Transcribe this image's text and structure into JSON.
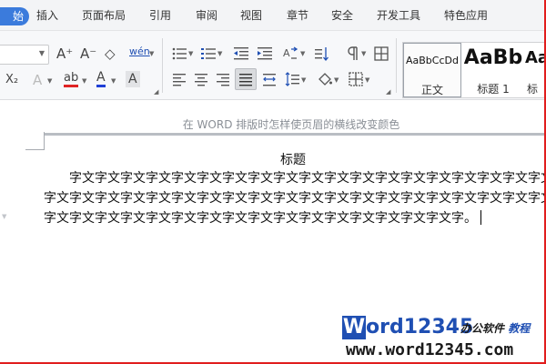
{
  "tabs": {
    "start": "始",
    "items": [
      "插入",
      "页面布局",
      "引用",
      "审阅",
      "视图",
      "章节",
      "安全",
      "开发工具",
      "特色应用"
    ]
  },
  "ribbon": {
    "font_name_value": "",
    "glyphs": {
      "grow_font": "A⁺",
      "shrink_font": "A⁻",
      "clear_format": "◇",
      "phonetic": "wén",
      "subscript": "X₂",
      "text_effect": "A",
      "highlight": "ab",
      "font_color": "A",
      "char_shading": "A"
    },
    "styles": [
      {
        "preview": "AaBbCcDd",
        "label": "正文"
      },
      {
        "preview": "AaBb",
        "label": "标题 1"
      },
      {
        "preview": "Aa",
        "label": "标"
      }
    ],
    "accent": "#3b7bdc"
  },
  "document": {
    "header_text": "在 WORD 排版时怎样使页眉的横线改变颜色",
    "title": "标题",
    "paragraph": "字文字文字文字文字文字文字文字文字文字文字文字文字文字文字文字文字文字文字文字文字文字文字文字文字文字文字文字文字文字文字文字文字文字文字文字文字文字文字文字文字文字文字文字文字文字文字文字文字文字文字文字文字文字文字文字。"
  },
  "watermark": {
    "logo_letter": "W",
    "logo_rest": "ord12345",
    "subtitle_left": "办公软件",
    "subtitle_right": "教程",
    "url": "www.word12345.com"
  }
}
